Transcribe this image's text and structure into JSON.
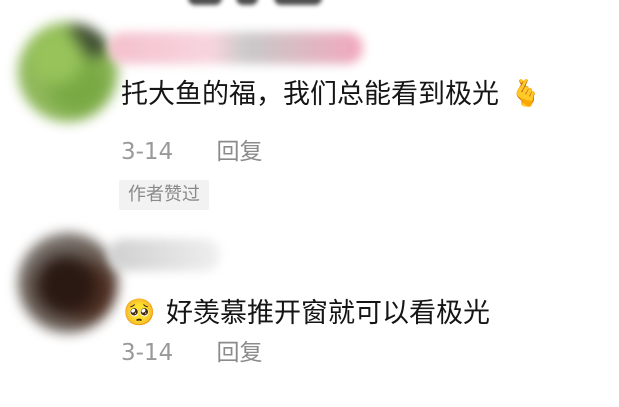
{
  "comments": [
    {
      "text": "托大鱼的福，我们总能看到极光",
      "emoji_after": "🫰",
      "date": "3-14",
      "reply_label": "回复",
      "badge": "作者赞过"
    },
    {
      "emoji_before": "🥺",
      "text": "好羡慕推开窗就可以看极光",
      "date": "3-14",
      "reply_label": "回复"
    }
  ]
}
